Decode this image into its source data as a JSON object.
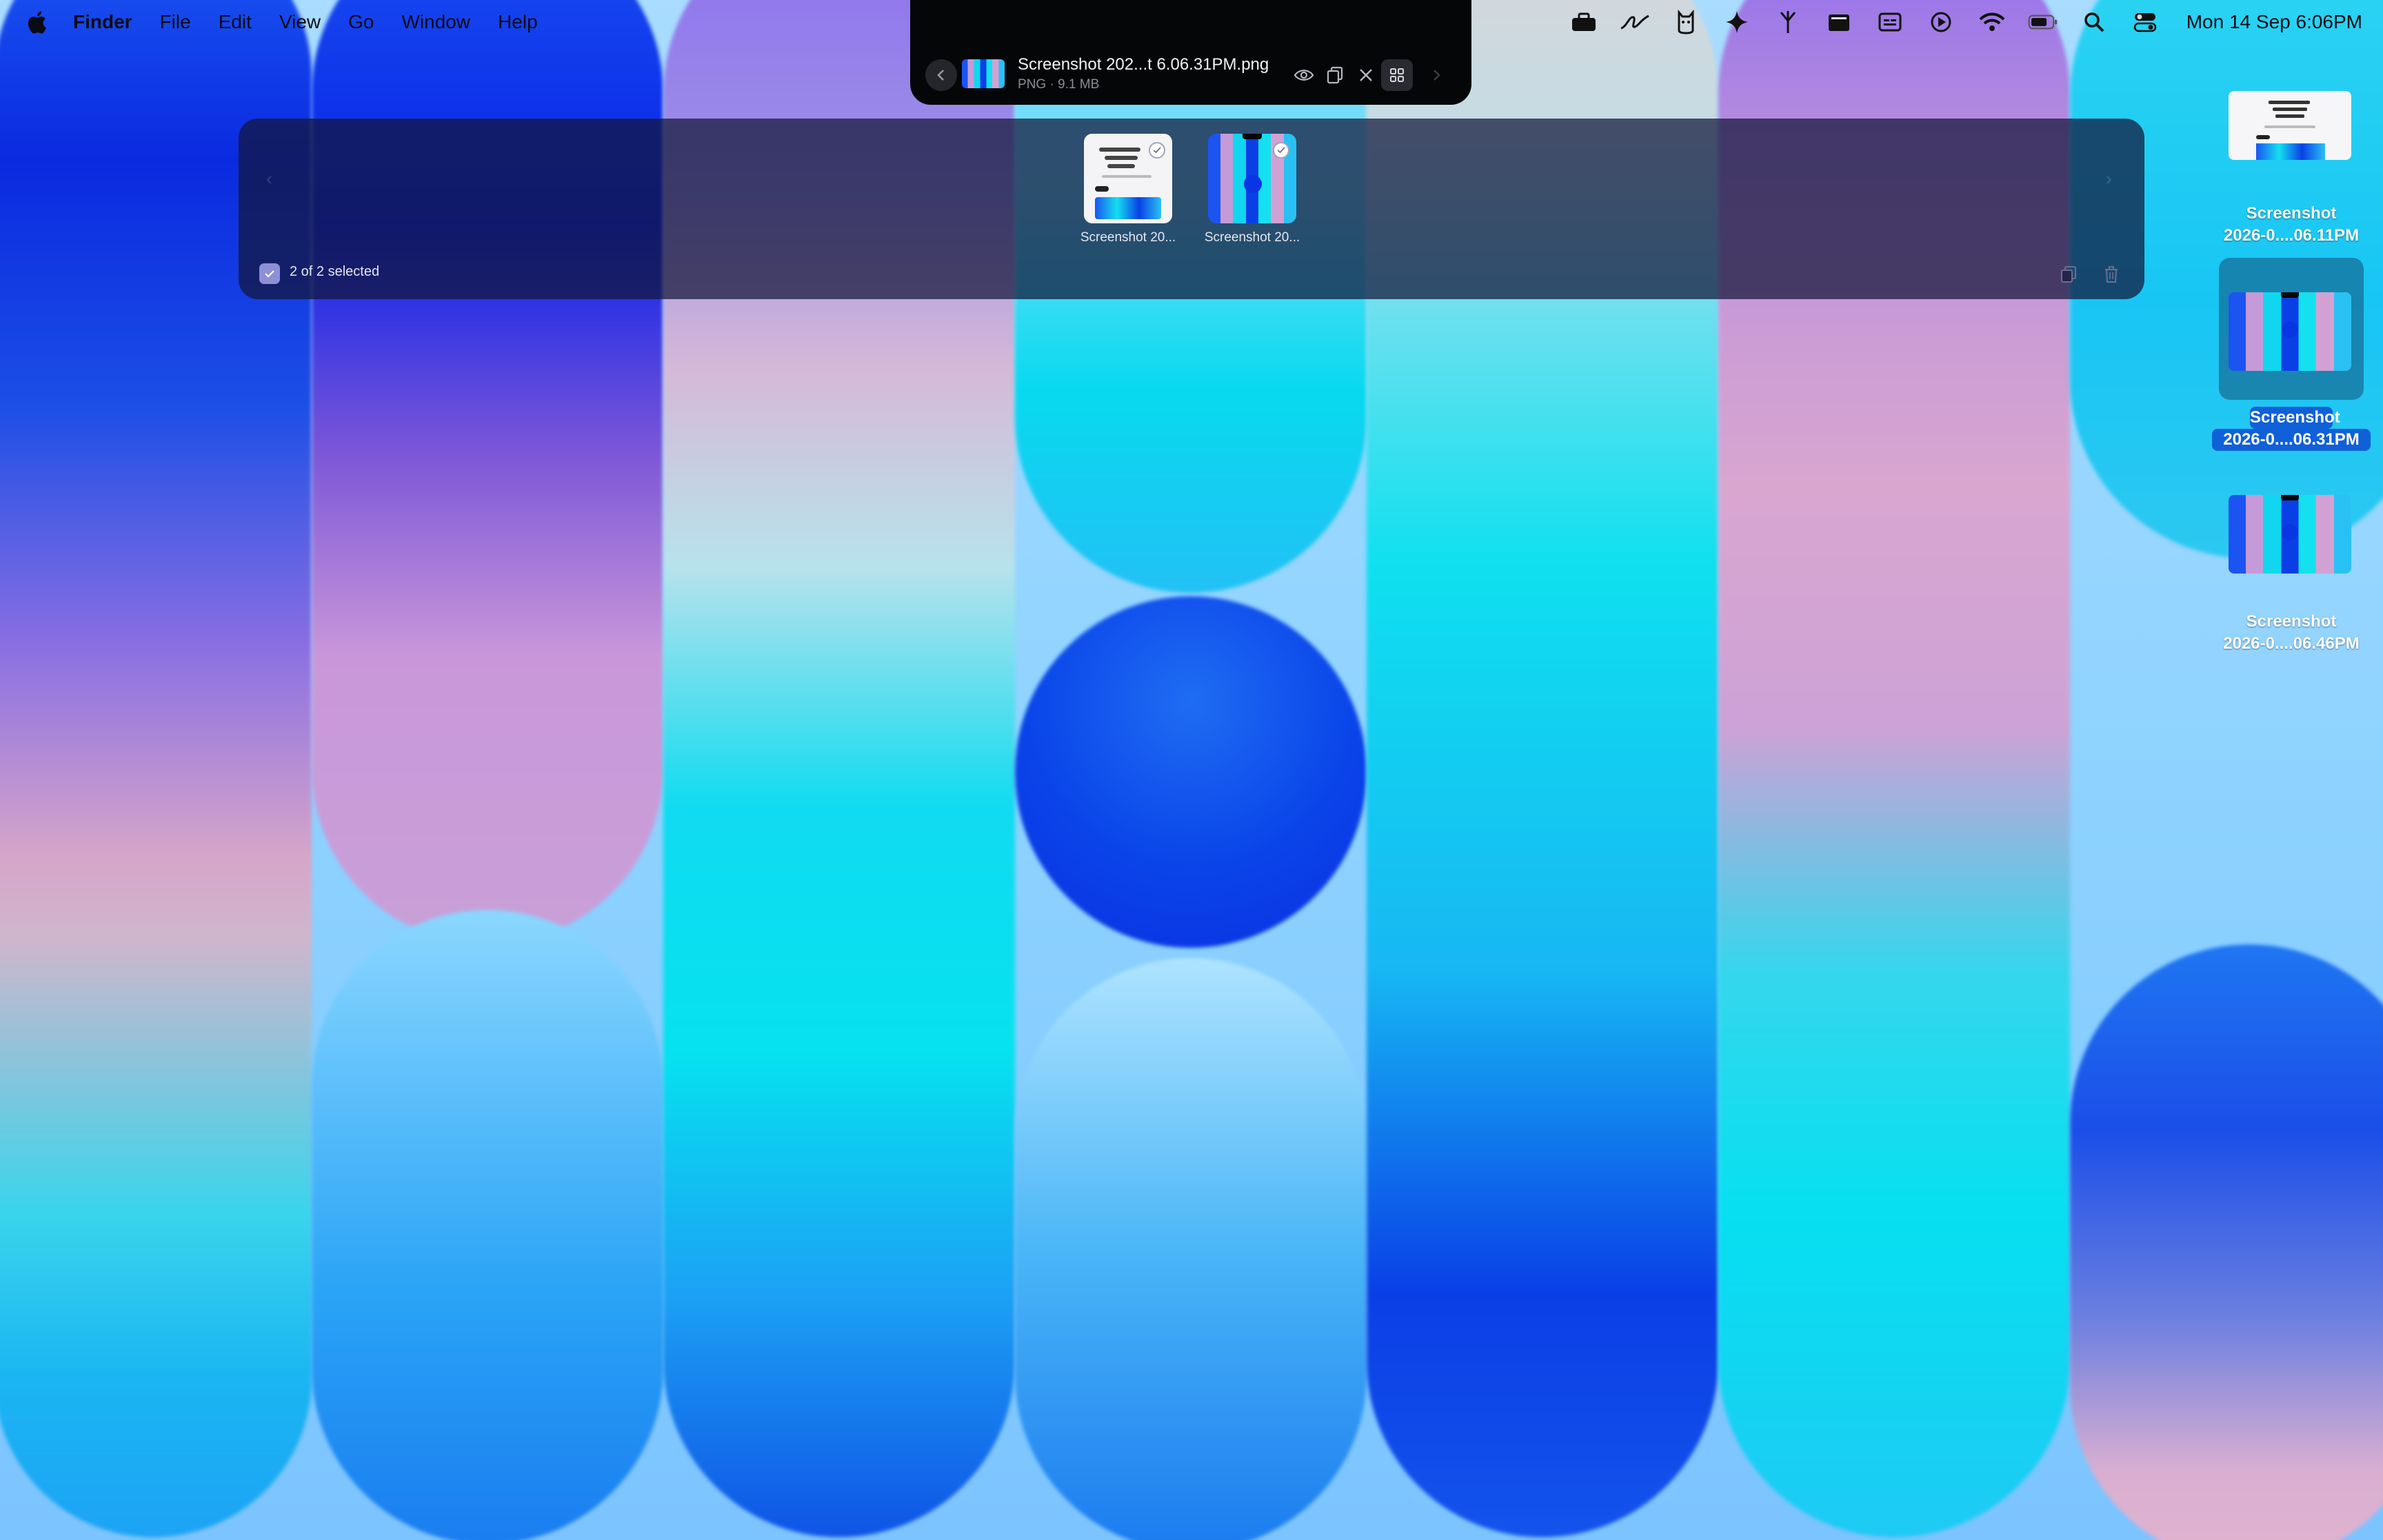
{
  "menubar": {
    "app_name": "Finder",
    "items": [
      "File",
      "Edit",
      "View",
      "Go",
      "Window",
      "Help"
    ],
    "status_icons": [
      "briefcase-icon",
      "signature-icon",
      "cat-icon",
      "sparkle-icon",
      "fork-icon",
      "clapperboard-icon",
      "caption-icon",
      "play-circle-icon",
      "wifi-icon",
      "battery-icon",
      "search-icon",
      "control-center-icon"
    ],
    "clock": "Mon 14 Sep  6:06PM"
  },
  "notch_toolbar": {
    "file_title": "Screenshot 202...t 6.06.31PM.png",
    "file_info": "PNG · 9.1 MB",
    "buttons": [
      "prev-icon",
      "eye-icon",
      "copy-icon",
      "close-icon",
      "grid-icon",
      "next-icon"
    ]
  },
  "panel": {
    "items": [
      {
        "label": "Screenshot 20...",
        "checked": true,
        "kind": "document"
      },
      {
        "label": "Screenshot 20...",
        "checked": true,
        "kind": "wallpaper"
      }
    ],
    "selection_text": "2 of 2 selected"
  },
  "desktop": {
    "icons": [
      {
        "line1": "Screenshot",
        "line2": "2026-0....06.11PM",
        "selected": false
      },
      {
        "line1": "Screenshot",
        "line2": "2026-0....06.31PM",
        "selected": true
      },
      {
        "line1": "Screenshot",
        "line2": "2026-0....06.46PM",
        "selected": false
      }
    ]
  },
  "colors": {
    "selection_blue": "#1060d9",
    "panel_bg": "#14163a",
    "notch_bg": "#050608"
  }
}
